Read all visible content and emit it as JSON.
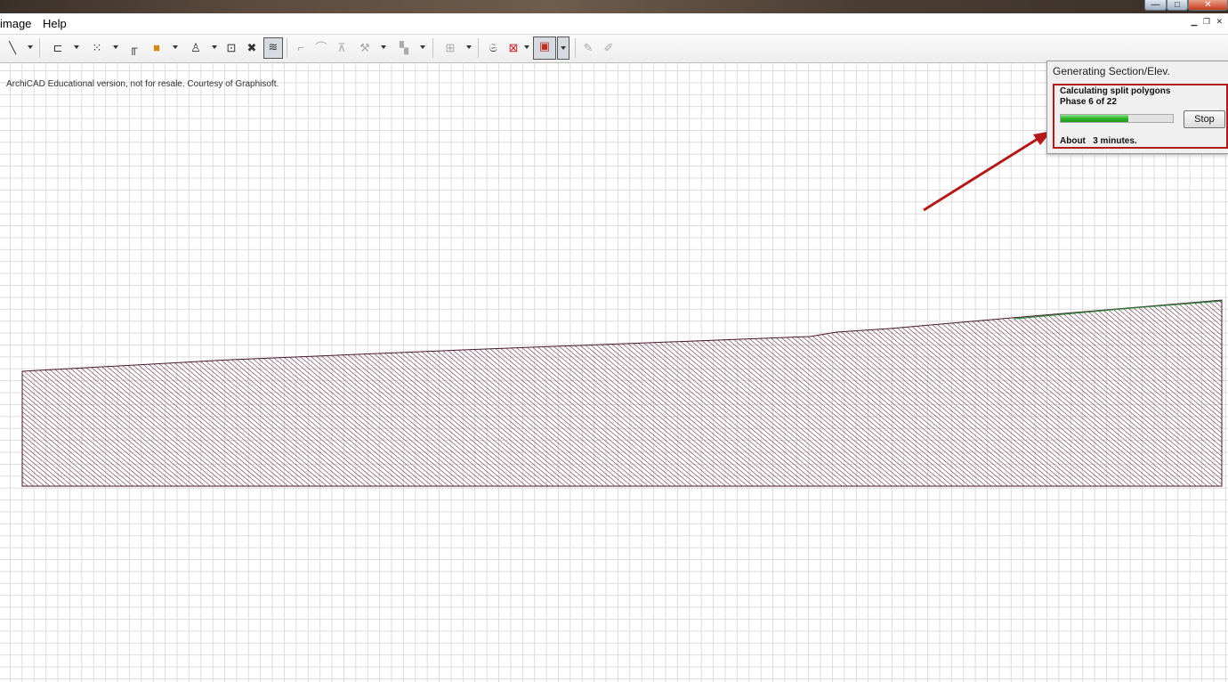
{
  "window": {
    "minimize": "—",
    "maximize": "□",
    "close": "✕"
  },
  "menu": {
    "items": [
      "image",
      "Help"
    ],
    "mdi_controls": "▁ ❐ ✕"
  },
  "canvas": {
    "watermark": "ArchiCAD Educational version, not for resale. Courtesy of Graphisoft."
  },
  "dialog": {
    "title": "Generating Section/Elev.",
    "task": "Calculating split polygons",
    "phase": "Phase 6 of 22",
    "progress_fraction": 0.6,
    "stop_label": "Stop",
    "eta": "About   3 minutes."
  },
  "colors": {
    "hatch": "#5a1f38",
    "terrain_top": "#2e8b3e",
    "highlight": "#b31b1b",
    "progress": "#2db52d"
  },
  "toolbar_icons": [
    "line-tool-icon",
    "dimension-tool-icon",
    "fill-tool-icon",
    "wall-end-icon",
    "layer-icon",
    "marker-icon",
    "label-icon",
    "delete-icon",
    "section-tool-icon",
    "arc-icon",
    "curve-icon",
    "elevate-icon",
    "hammer-icon",
    "group-icon",
    "select-icon",
    "library-icon",
    "grid-icon",
    "render-icon",
    "pencil-icon",
    "pencil-alt-icon"
  ]
}
